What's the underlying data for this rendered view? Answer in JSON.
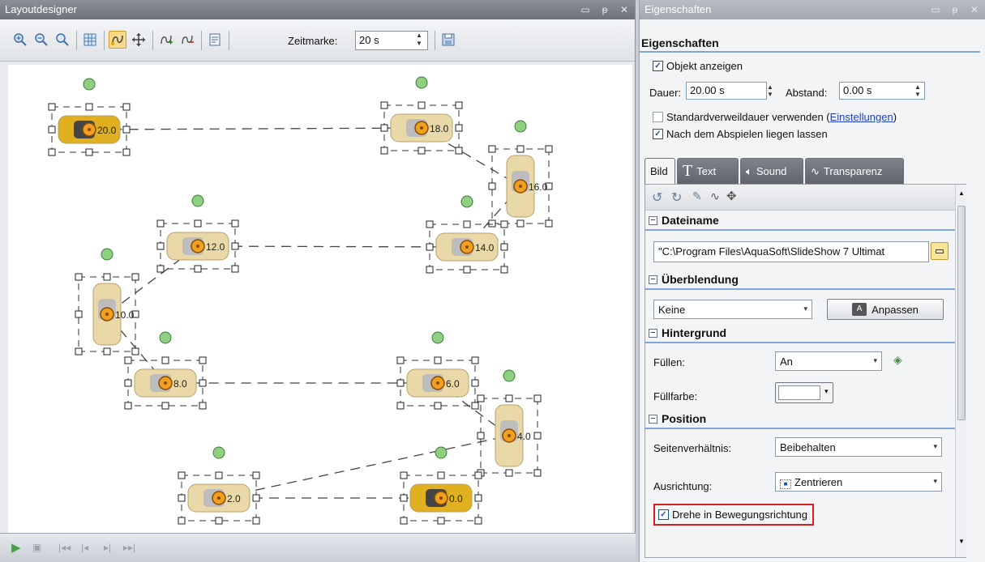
{
  "left_panel": {
    "title": "Layoutdesigner",
    "title_buttons": [
      "▫",
      "ᵽ",
      "✕"
    ],
    "zeitmarke_label": "Zeitmarke:",
    "zeitmarke_value": "20 s",
    "marker_labels": [
      "20.0",
      "18.0",
      "16.0",
      "14.0",
      "12.0",
      "10.0",
      "8.0",
      "6.0",
      "4.0",
      "2.0",
      "0.0"
    ]
  },
  "right_panel": {
    "title": "Eigenschaften",
    "title_buttons": [
      "▫",
      "ᵽ",
      "✕"
    ],
    "section_title": "Eigenschaften",
    "objekt_anzeigen": "Objekt anzeigen",
    "dauer_label": "Dauer:",
    "dauer_value": "20.00 s",
    "abstand_label": "Abstand:",
    "abstand_value": "0.00 s",
    "standard_text": "Standardverweildauer verwenden (",
    "einstellungen_link": "Einstellungen",
    "standard_close": ")",
    "nach_abspielen": "Nach dem Abspielen liegen lassen",
    "tabs": [
      "Bild",
      "Text",
      "Sound",
      "Transparenz"
    ],
    "groups": {
      "dateiname": "Dateiname",
      "ueberblendung": "Überblendung",
      "hintergrund": "Hintergrund",
      "position": "Position"
    },
    "dateiname_value": "\"C:\\Program Files\\AquaSoft\\SlideShow 7 Ultimat",
    "ueberblendung_value": "Keine",
    "anpassen_label": "Anpassen",
    "fuellen_label": "Füllen:",
    "fuellen_value": "An",
    "fuellfarbe_label": "Füllfarbe:",
    "seitenverhaeltnis_label": "Seitenverhältnis:",
    "seitenverhaeltnis_value": "Beibehalten",
    "ausrichtung_label": "Ausrichtung:",
    "ausrichtung_value": "Zentrieren",
    "drehe_label": "Drehe in Bewegungsrichtung"
  },
  "colors": {
    "accent_line": "#7fa7dc",
    "highlight_frame": "#d81e1e",
    "marker_orange": "#f0a020",
    "handle_green": "#8fd080"
  }
}
